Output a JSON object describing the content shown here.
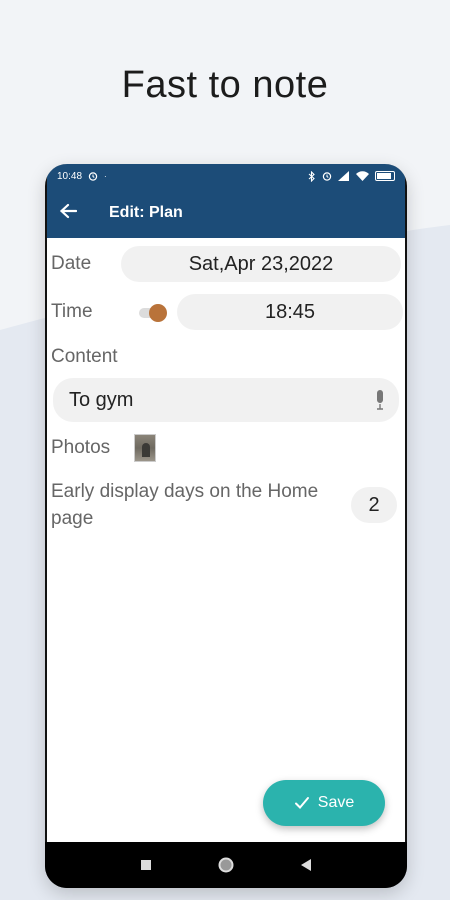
{
  "headline": "Fast to note",
  "status_bar": {
    "time": "10:48"
  },
  "app_bar": {
    "title": "Edit: Plan"
  },
  "form": {
    "date_label": "Date",
    "date_value": "Sat,Apr 23,2022",
    "time_label": "Time",
    "time_value": "18:45",
    "time_toggle_on": true,
    "content_label": "Content",
    "content_value": "To gym",
    "photos_label": "Photos",
    "early_label": "Early display days on the Home page",
    "early_days": "2"
  },
  "save_button": {
    "label": "Save"
  },
  "colors": {
    "app_bar": "#1c4c78",
    "accent_teal": "#2bb3ad",
    "toggle_knob": "#b9733a",
    "field_bg": "#f1f1f1"
  },
  "icons": {
    "back": "arrow-left-icon",
    "mic": "microphone-icon",
    "check": "check-icon",
    "nav_recent": "square-icon",
    "nav_home": "circle-icon",
    "nav_back": "triangle-back-icon"
  }
}
